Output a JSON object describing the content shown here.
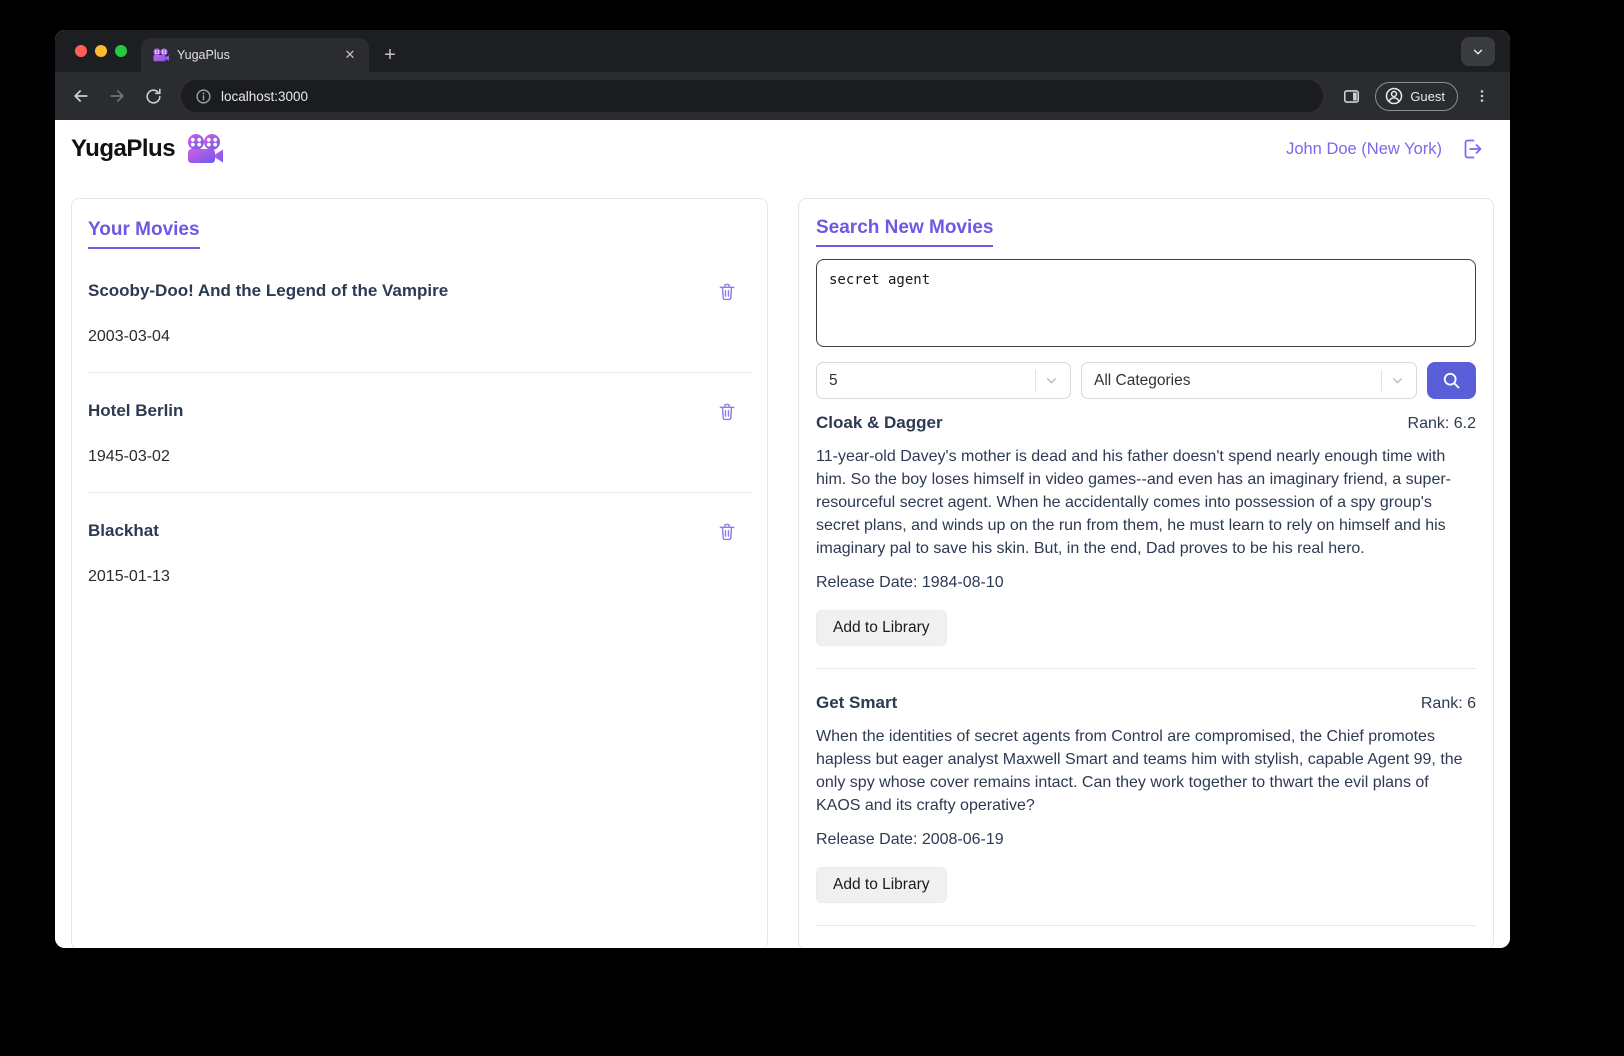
{
  "browser": {
    "tab": {
      "title": "YugaPlus"
    },
    "address": {
      "url": "localhost:3000"
    },
    "profile": {
      "label": "Guest"
    }
  },
  "app": {
    "brand": "YugaPlus",
    "user_label": "John Doe (New York)"
  },
  "library": {
    "heading": "Your Movies",
    "movies": [
      {
        "title": "Scooby-Doo! And the Legend of the Vampire",
        "release_date": "2003-03-04"
      },
      {
        "title": "Hotel Berlin",
        "release_date": "1945-03-02"
      },
      {
        "title": "Blackhat",
        "release_date": "2015-01-13"
      }
    ]
  },
  "search": {
    "heading": "Search New Movies",
    "query": "secret agent",
    "limit_value": "5",
    "category_value": "All Categories",
    "results": [
      {
        "title": "Cloak & Dagger",
        "rank_label": "Rank: 6.2",
        "description": "11-year-old Davey's mother is dead and his father doesn't spend nearly enough time with him. So the boy loses himself in video games--and even has an imaginary friend, a super-resourceful secret agent. When he accidentally comes into possession of a spy group's secret plans, and winds up on the run from them, he must learn to rely on himself and his imaginary pal to save his skin. But, in the end, Dad proves to be his real hero.",
        "release_label": "Release Date: 1984-08-10",
        "add_label": "Add to Library"
      },
      {
        "title": "Get Smart",
        "rank_label": "Rank: 6",
        "description": "When the identities of secret agents from Control are compromised, the Chief promotes hapless but eager analyst Maxwell Smart and teams him with stylish, capable Agent 99, the only spy whose cover remains intact. Can they work together to thwart the evil plans of KAOS and its crafty operative?",
        "release_label": "Release Date: 2008-06-19",
        "add_label": "Add to Library"
      }
    ]
  },
  "colors": {
    "accent_purple": "#7158e2",
    "link_purple": "#7b68ee",
    "trash_purple": "#8d7bea",
    "search_button_indigo": "#5a5fd9"
  }
}
